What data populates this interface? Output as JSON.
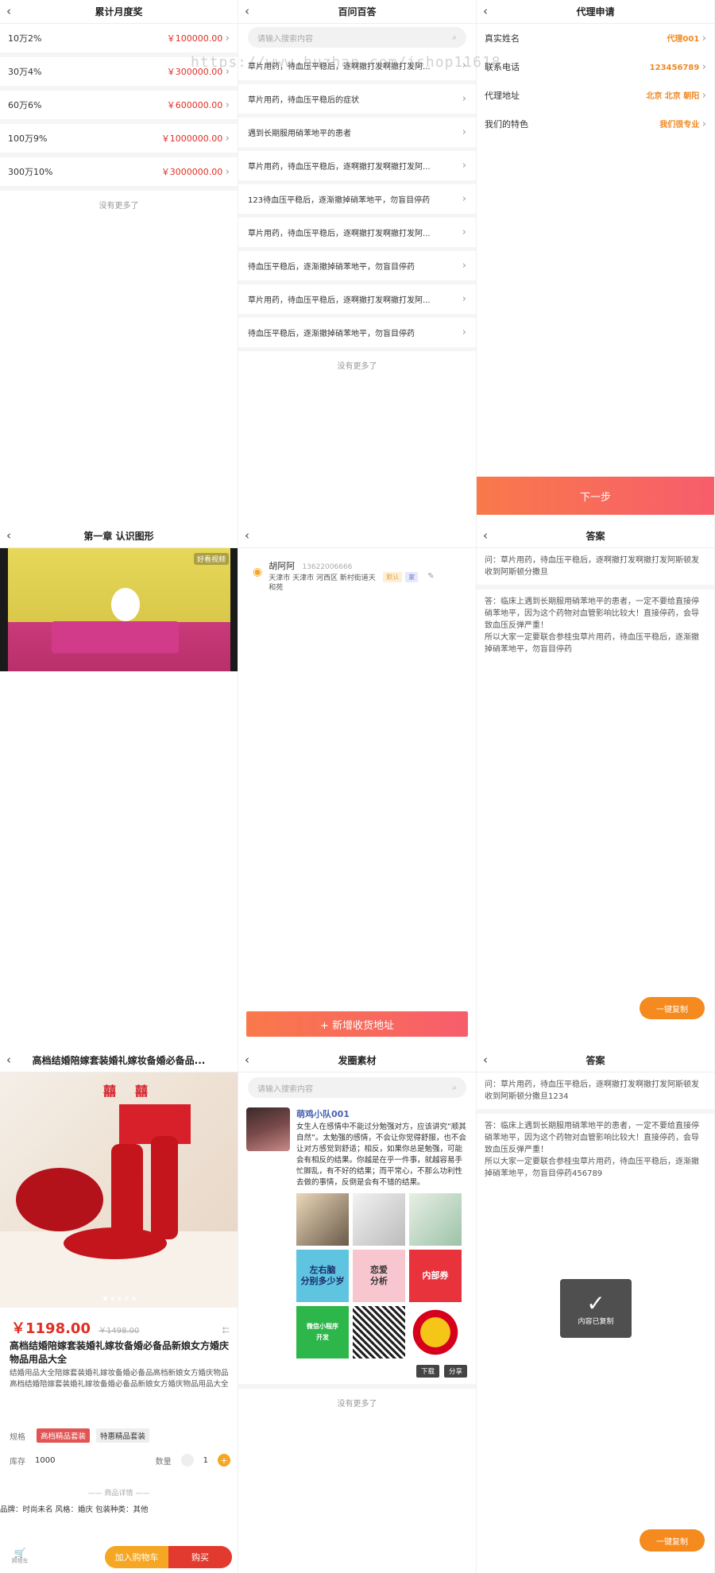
{
  "watermark": "https://www.huzhan.com/ishop11618",
  "monthly": {
    "title": "累计月度奖",
    "rows": [
      {
        "label": "10万2%",
        "amount": "￥100000.00"
      },
      {
        "label": "30万4%",
        "amount": "￥300000.00"
      },
      {
        "label": "60万6%",
        "amount": "￥600000.00"
      },
      {
        "label": "100万9%",
        "amount": "￥1000000.00"
      },
      {
        "label": "300万10%",
        "amount": "￥3000000.00"
      }
    ],
    "no_more": "没有更多了"
  },
  "faq": {
    "title": "百问百答",
    "search_placeholder": "请输入搜索内容",
    "items": [
      "草片用药，待血压平稳后，逐啊撤打发啊撤打发阿...",
      "草片用药，待血压平稳后的症状",
      "遇到长期服用硝苯地平的患者",
      "草片用药，待血压平稳后，逐啊撤打发啊撤打发阿...",
      "123待血压平稳后，逐渐撤掉硝苯地平，勿盲目停药",
      "草片用药，待血压平稳后，逐啊撤打发啊撤打发阿...",
      "待血压平稳后，逐渐撤掉硝苯地平，勿盲目停药",
      "草片用药，待血压平稳后，逐啊撤打发啊撤打发阿...",
      "待血压平稳后，逐渐撤掉硝苯地平，勿盲目停药"
    ],
    "no_more": "没有更多了"
  },
  "agent": {
    "title": "代理申请",
    "rows": [
      {
        "label": "真实姓名",
        "value": "代理001"
      },
      {
        "label": "联系电话",
        "value": "123456789"
      },
      {
        "label": "代理地址",
        "value": "北京 北京 朝阳"
      },
      {
        "label": "我们的特色",
        "value": "我们很专业"
      }
    ],
    "next": "下一步"
  },
  "video": {
    "title": "第一章 认识图形",
    "badge": "好看视频"
  },
  "address": {
    "name": "胡阿阿",
    "phone": "13622006666",
    "detail": "天津市 天津市 河西区 新村街道天和苑",
    "tag_default": "默认",
    "tag_home": "家",
    "add_button": "+ 新增收货地址"
  },
  "answer1": {
    "title": "答案",
    "question": "问：草片用药，待血压平稳后，逐啊撤打发啊撤打发阿斯顿发收到阿斯顿分撒旦",
    "answer": "答：临床上遇到长期服用硝苯地平的患者，一定不要给直接停硝苯地平，因为这个药物对血管影响比较大！直接停药，会导致血压反弹严重！\n所以大家一定要联合参桂虫草片用药，待血压平稳后，逐渐撤掉硝苯地平，勿盲目停药",
    "copy": "一键复制"
  },
  "product": {
    "title": "高档结婚陪嫁套装婚礼嫁妆备婚必备品...",
    "xi": "囍",
    "price": "￥1198.00",
    "old_price": "￥1498.00",
    "name": "高档结婚陪嫁套装婚礼嫁妆备婚必备品新娘女方婚庆物品用品大全",
    "desc": "结婚用品大全陪嫁套装婚礼嫁妆备婚必备品高档新娘女方婚庆物品 高档结婚陪嫁套装婚礼嫁妆备婚必备品新娘女方婚庆物品用品大全",
    "spec_label": "规格",
    "spec1": "高档精品套装",
    "spec2": "特惠精品套装",
    "stock_label": "库存",
    "stock": "1000",
    "qty_label": "数量",
    "qty": "1",
    "plus": "+",
    "detail_header": "—— 商品详情 ——",
    "attrs": "品牌：时尚未名  风格：婚庆  包装种类：其他",
    "cart": "购物车",
    "add_cart": "加入购物车",
    "buy": "购买"
  },
  "material": {
    "title": "发圈素材",
    "search_placeholder": "请输入搜索内容",
    "user": "萌鸡小队001",
    "text": "女生人在感情中不能过分勉强对方，应该讲究“顺其自然”。太勉强的感情，不会让你觉得舒服，也不会让对方感觉到舒适；相反，如果你总是勉强，可能会有相反的结果。你越是在乎一件事，就越容易手忙脚乱，有不好的结果；而平常心，不那么功利性去做的事情，反倒是会有不错的结果。",
    "thumbs": [
      "",
      "",
      "",
      "左右脑\n分别多少岁",
      "恋爱\n分析",
      "内部券",
      "微信小程序\n开发",
      "",
      ""
    ],
    "download": "下载",
    "share": "分享",
    "no_more": "没有更多了"
  },
  "answer2": {
    "title": "答案",
    "question": "问：草片用药，待血压平稳后，逐啊撤打发啊撤打发阿斯顿发收到阿斯顿分撒旦1234",
    "answer": "答：临床上遇到长期服用硝苯地平的患者，一定不要给直接停硝苯地平，因为这个药物对血管影响比较大！直接停药，会导致血压反弹严重！\n所以大家一定要联合参桂虫草片用药，待血压平稳后，逐渐撤掉硝苯地平，勿盲目停药456789",
    "toast": "内容已复制",
    "copy": "一键复制"
  }
}
